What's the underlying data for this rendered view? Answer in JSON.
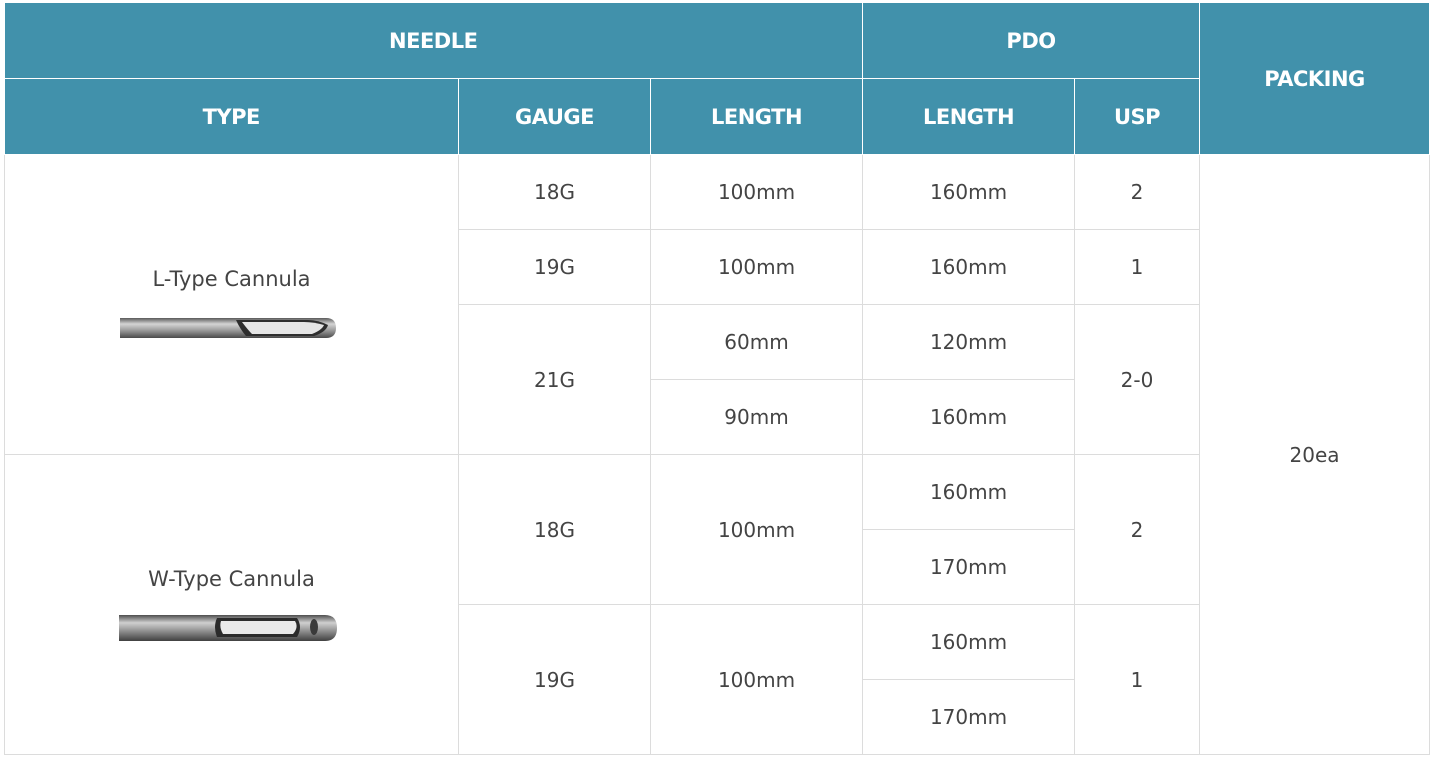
{
  "header": {
    "needle": "NEEDLE",
    "pdo": "PDO",
    "packing": "PACKING",
    "type": "TYPE",
    "gauge": "GAUGE",
    "needle_length": "LENGTH",
    "pdo_length": "LENGTH",
    "usp": "USP"
  },
  "packing_value": "20ea",
  "colors": {
    "header_bg": "#4191ab",
    "header_text": "#ffffff",
    "body_text": "#444444",
    "grid_line": "#dcdcdc"
  },
  "groups": [
    {
      "type": "L-Type Cannula",
      "image_icon": "l-type-cannula-photo",
      "gauges": [
        {
          "gauge": "18G",
          "needle_lengths": [
            {
              "length": "100mm",
              "pdo": [
                {
                  "length": "160mm",
                  "usp": "2"
                }
              ]
            }
          ]
        },
        {
          "gauge": "19G",
          "needle_lengths": [
            {
              "length": "100mm",
              "pdo": [
                {
                  "length": "160mm",
                  "usp": "1"
                }
              ]
            }
          ]
        },
        {
          "gauge": "21G",
          "needle_lengths": [
            {
              "length": "60mm",
              "pdo": [
                {
                  "length": "120mm"
                }
              ]
            },
            {
              "length": "90mm",
              "pdo": [
                {
                  "length": "160mm"
                }
              ]
            }
          ],
          "usp": "2-0"
        }
      ]
    },
    {
      "type": "W-Type Cannula",
      "image_icon": "w-type-cannula-photo",
      "gauges": [
        {
          "gauge": "18G",
          "needle_lengths": [
            {
              "length": "100mm",
              "pdo": [
                {
                  "length": "160mm"
                },
                {
                  "length": "170mm"
                }
              ]
            }
          ],
          "usp": "2"
        },
        {
          "gauge": "19G",
          "needle_lengths": [
            {
              "length": "100mm",
              "pdo": [
                {
                  "length": "160mm"
                },
                {
                  "length": "170mm"
                }
              ]
            }
          ],
          "usp": "1"
        }
      ]
    }
  ]
}
